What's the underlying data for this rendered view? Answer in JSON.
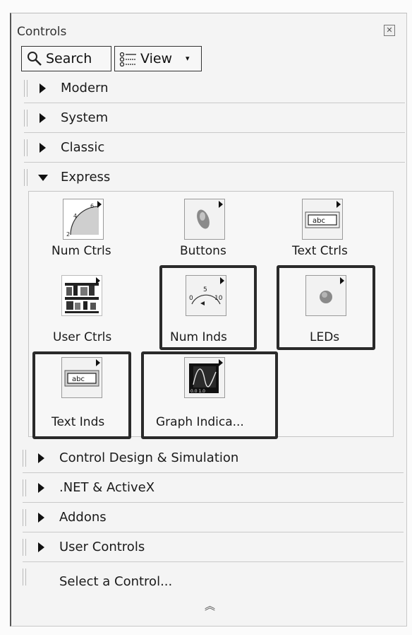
{
  "window": {
    "title": "Controls",
    "close_icon": "close-icon"
  },
  "toolbar": {
    "search_label": "Search",
    "view_label": "View"
  },
  "categories_top": [
    {
      "label": "Modern",
      "expanded": false
    },
    {
      "label": "System",
      "expanded": false
    },
    {
      "label": "Classic",
      "expanded": false
    },
    {
      "label": "Express",
      "expanded": true
    }
  ],
  "express_items": [
    {
      "label": "Num Ctrls"
    },
    {
      "label": "Buttons"
    },
    {
      "label": "Text Ctrls"
    },
    {
      "label": "User Ctrls"
    },
    {
      "label": "Num Inds"
    },
    {
      "label": "LEDs"
    },
    {
      "label": "Text Inds"
    },
    {
      "label": "Graph Indica..."
    }
  ],
  "icon_text": {
    "abc": "abc"
  },
  "categories_bottom": [
    {
      "label": "Control Design & Simulation"
    },
    {
      "label": ".NET & ActiveX"
    },
    {
      "label": "Addons"
    },
    {
      "label": "User Controls"
    }
  ],
  "footer": {
    "select_label": "Select a Control...",
    "collapse_icon": "double-chevron-up-icon"
  }
}
